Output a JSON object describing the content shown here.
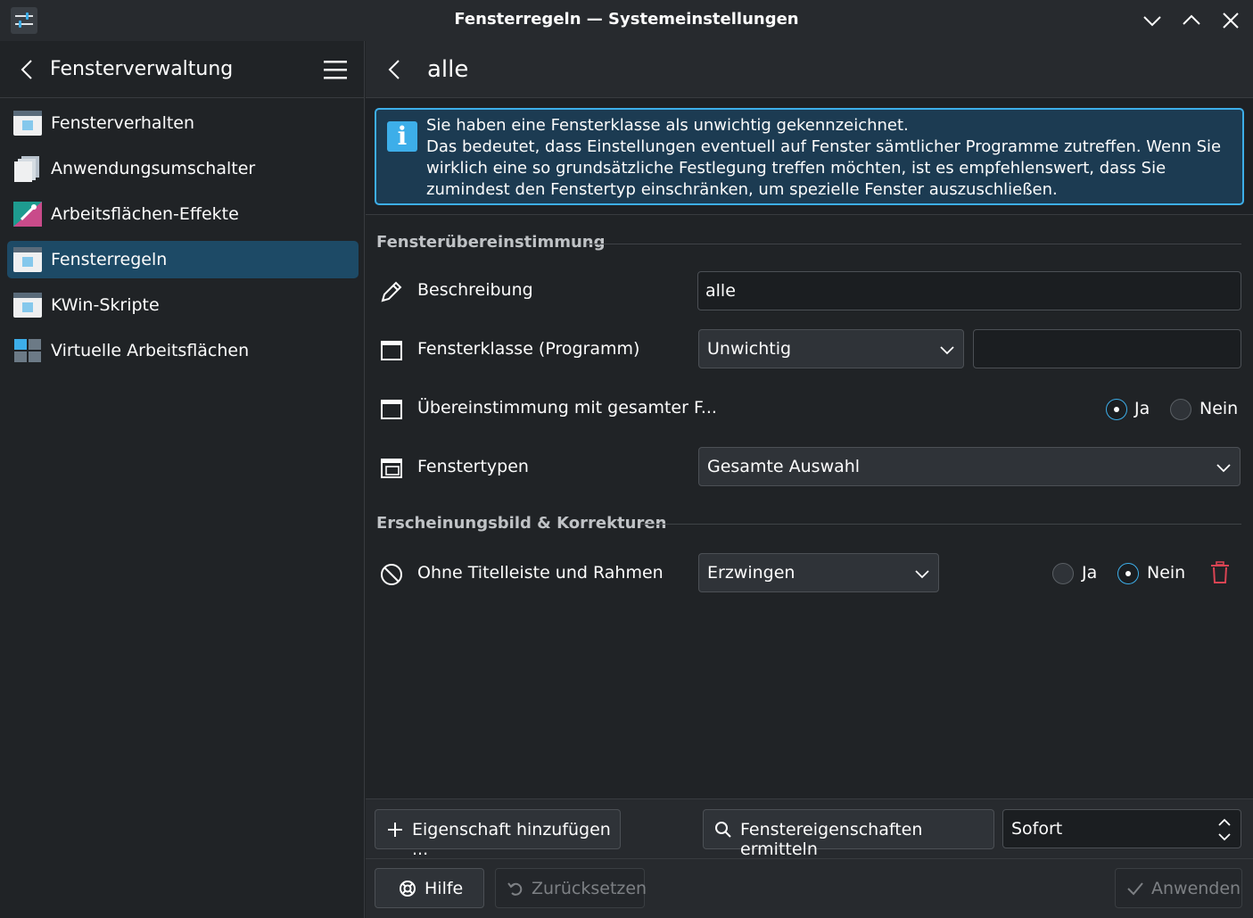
{
  "window": {
    "title": "Fensterregeln — Systemeinstellungen"
  },
  "sidebar": {
    "header_title": "Fensterverwaltung",
    "items": [
      {
        "label": "Fensterverhalten",
        "icon": "window-behavior-icon"
      },
      {
        "label": "Anwendungsumschalter",
        "icon": "task-switcher-icon"
      },
      {
        "label": "Arbeitsflächen-Effekte",
        "icon": "desktop-effects-icon"
      },
      {
        "label": "Fensterregeln",
        "icon": "window-rules-icon",
        "active": true
      },
      {
        "label": "KWin-Skripte",
        "icon": "kwin-scripts-icon"
      },
      {
        "label": "Virtuelle Arbeitsflächen",
        "icon": "virtual-desktops-icon"
      }
    ]
  },
  "main": {
    "header_title": "alle",
    "banner": {
      "line1": "Sie haben eine Fensterklasse als unwichtig gekennzeichnet.",
      "line2": "Das bedeutet, dass Einstellungen eventuell auf Fenster sämtlicher Programme zutreffen. Wenn Sie wirklich eine so grundsätzliche Festlegung treffen möchten, ist es empfehlenswert, dass Sie zumindest den Fenstertyp einschränken, um spezielle Fenster auszuschließen."
    },
    "section_match": "Fensterübereinstimmung",
    "rows": {
      "description": {
        "label": "Beschreibung",
        "value": "alle"
      },
      "window_class": {
        "label": "Fensterklasse (Programm)",
        "combo": "Unwichtig",
        "value": ""
      },
      "whole_match": {
        "label": "Übereinstimmung mit gesamter F...",
        "yes": "Ja",
        "no": "Nein",
        "selected": "Ja"
      },
      "window_types": {
        "label": "Fenstertypen",
        "combo": "Gesamte Auswahl"
      }
    },
    "section_appearance": "Erscheinungsbild & Korrekturen",
    "appearance": {
      "no_titlebar": {
        "label": "Ohne Titelleiste und Rahmen",
        "combo": "Erzwingen",
        "yes": "Ja",
        "no": "Nein",
        "selected": "Nein"
      }
    }
  },
  "toolbar": {
    "add_property": "Eigenschaft hinzufügen ...",
    "detect_properties": "Fenstereigenschaften ermitteln",
    "delay_value": "Sofort"
  },
  "footer": {
    "help": "Hilfe",
    "reset": "Zurücksetzen",
    "apply": "Anwenden"
  },
  "colors": {
    "accent": "#3daee9",
    "active_item": "#1d4a66",
    "delete": "#da4453"
  }
}
